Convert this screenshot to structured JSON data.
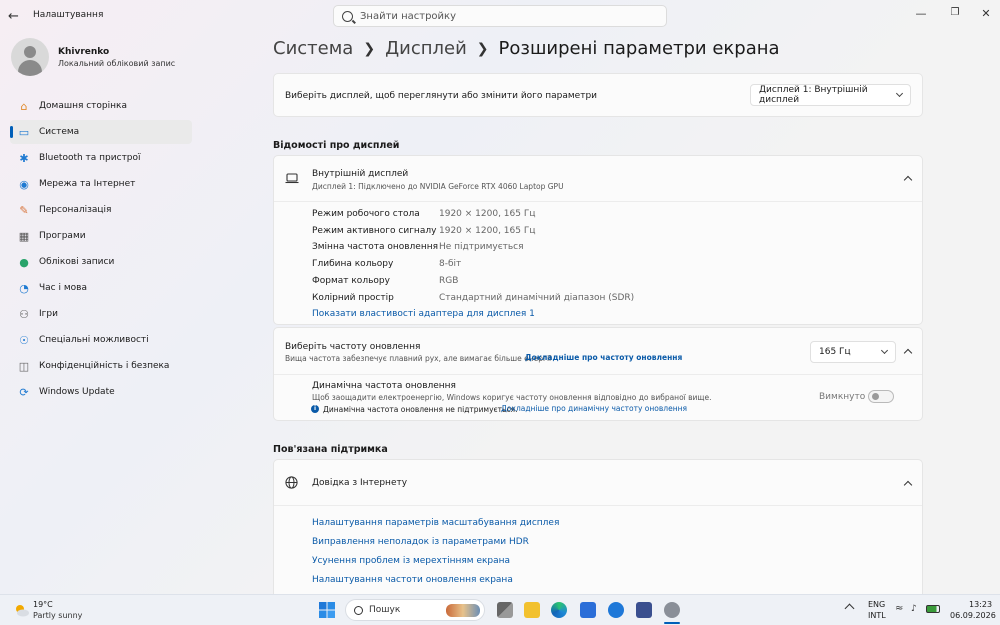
{
  "window": {
    "title": "Налаштування"
  },
  "search": {
    "placeholder": "Знайти настройку"
  },
  "user": {
    "name": "Khivrenko",
    "account": "Локальний обліковий запис"
  },
  "sidebar": {
    "items": [
      {
        "label": "Домашня сторінка",
        "icon": "home-icon",
        "color": "#e08a2c"
      },
      {
        "label": "Система",
        "icon": "system-icon",
        "color": "#1f7ad1",
        "active": true
      },
      {
        "label": "Bluetooth та пристрої",
        "icon": "bluetooth-icon",
        "color": "#1f7ad1"
      },
      {
        "label": "Мережа та Інтернет",
        "icon": "network-icon",
        "color": "#1f7ad1"
      },
      {
        "label": "Персоналізація",
        "icon": "brush-icon",
        "color": "#d8743a"
      },
      {
        "label": "Програми",
        "icon": "apps-icon",
        "color": "#555"
      },
      {
        "label": "Облікові записи",
        "icon": "accounts-icon",
        "color": "#29a36a"
      },
      {
        "label": "Час і мова",
        "icon": "time-language-icon",
        "color": "#1f7ad1"
      },
      {
        "label": "Ігри",
        "icon": "gaming-icon",
        "color": "#555"
      },
      {
        "label": "Спеціальні можливості",
        "icon": "accessibility-icon",
        "color": "#1f7ad1"
      },
      {
        "label": "Конфіденційність і безпека",
        "icon": "shield-icon",
        "color": "#666"
      },
      {
        "label": "Windows Update",
        "icon": "update-icon",
        "color": "#1f7ad1"
      }
    ]
  },
  "breadcrumb": {
    "items": [
      "Система",
      "Дисплей"
    ],
    "current": "Розширені параметри екрана"
  },
  "display_select": {
    "label": "Виберіть дисплей, щоб переглянути або змінити його параметри",
    "value": "Дисплей 1: Внутрішній дисплей"
  },
  "display_info": {
    "heading": "Відомості про дисплей",
    "name": "Внутрішній дисплей",
    "subtitle": "Дисплей 1: Підключено до NVIDIA GeForce RTX 4060 Laptop GPU",
    "rows": [
      {
        "key": "Режим робочого стола",
        "value": "1920 × 1200, 165 Гц"
      },
      {
        "key": "Режим активного сигналу",
        "value": "1920 × 1200, 165 Гц"
      },
      {
        "key": "Змінна частота оновлення",
        "value": "Не підтримується"
      },
      {
        "key": "Глибина кольору",
        "value": "8-біт"
      },
      {
        "key": "Формат кольору",
        "value": "RGB"
      },
      {
        "key": "Колірний простір",
        "value": "Стандартний динамічний діапазон (SDR)"
      }
    ],
    "adapter_link": "Показати властивості адаптера для дисплея 1"
  },
  "refresh": {
    "label": "Виберіть частоту оновлення",
    "desc": "Вища частота забезпечує плавний рух, але вимагає більше енергії",
    "more_link": "Докладніше про частоту оновлення",
    "value": "165 Гц",
    "dynamic_label": "Динамічна частота оновлення",
    "dynamic_desc": "Щоб заощадити електроенергію, Windows коригує частоту оновлення відповідно до вибраної вище.",
    "dynamic_note": "Динамічна частота оновлення не підтримується.",
    "dynamic_link": "Докладніше про динамічну частоту оновлення",
    "toggle_state": "Вимкнуто"
  },
  "support": {
    "heading": "Пов'язана підтримка",
    "title": "Довідка з Інтернету",
    "links": [
      "Налаштування параметрів масштабування дисплея",
      "Виправлення неполадок із параметрами HDR",
      "Усунення проблем із мерехтінням екрана",
      "Налаштування частоти оновлення екрана"
    ]
  },
  "taskbar": {
    "weather_temp": "19°C",
    "weather_desc": "Partly sunny",
    "search_label": "Пошук",
    "lang_1": "ENG",
    "lang_2": "INTL",
    "time": "13:23",
    "date": "06.09.2026"
  }
}
